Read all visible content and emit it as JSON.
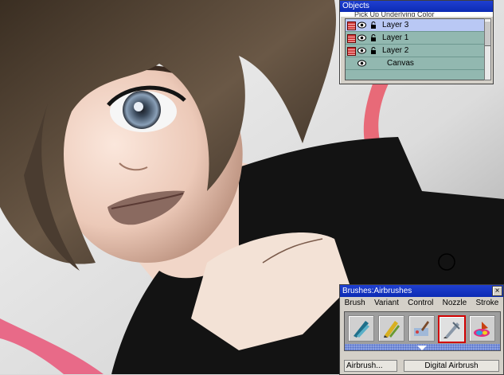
{
  "objects_panel": {
    "title": "Objects",
    "subtitle": "Pick Up Underlying Color",
    "layers": [
      {
        "name": "Layer 3",
        "selected": true,
        "locked": true
      },
      {
        "name": "Layer 1",
        "selected": false,
        "locked": true
      },
      {
        "name": "Layer 2",
        "selected": false,
        "locked": true
      },
      {
        "name": "Canvas",
        "selected": false,
        "locked": false
      }
    ]
  },
  "brushes_panel": {
    "title": "Brushes:Airbrushes",
    "close_label": "×",
    "menu": [
      "Brush",
      "Variant",
      "Control",
      "Nozzle",
      "Stroke"
    ],
    "brush_icons": [
      "calligraphy-pens-icon",
      "pencils-icon",
      "palette-knife-icon",
      "airbrush-icon",
      "color-wheel-icon"
    ],
    "active_brush": "airbrush-icon",
    "variant_field": "Airbrush...",
    "brush_name": "Digital Airbrush"
  },
  "colors": {
    "titlebar": "#0c2bb4",
    "layer_list": "#92b8b0",
    "layer_selected": "#b9c8f4",
    "active_brush_border": "#d00000"
  }
}
